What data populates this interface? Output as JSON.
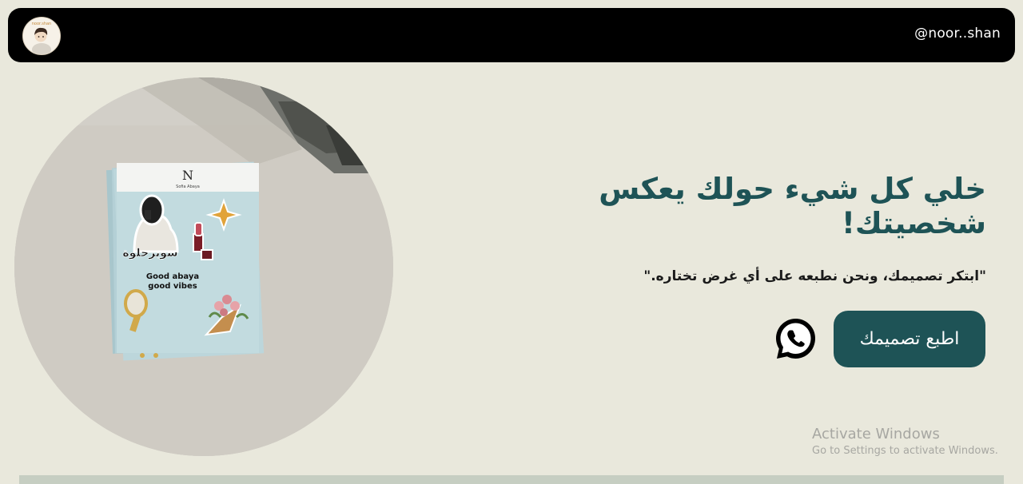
{
  "header": {
    "handle": "@noor..shan",
    "logo_text": "noor.shan"
  },
  "hero": {
    "headline": "خلي كل شيء حولك يعكس شخصيتك!",
    "tagline": "\"ابتكر تصميمك، ونحن نطبعه على أي غرض تختاره.\"",
    "cta_label": "اطبع تصميمك",
    "photo": {
      "sticker_text_1": "سوبرحلوة",
      "sticker_text_2": "Good abaya",
      "sticker_text_3": "good vibes",
      "brand": "Sofia Abaya"
    }
  },
  "contact": {
    "icon": "whatsapp-icon"
  },
  "system_watermark": {
    "title": "Activate Windows",
    "subtitle": "Go to Settings to activate Windows."
  },
  "colors": {
    "background": "#e9e8dc",
    "header_bg": "#000000",
    "accent": "#1e5356",
    "bottom_band": "#c6cec2"
  }
}
